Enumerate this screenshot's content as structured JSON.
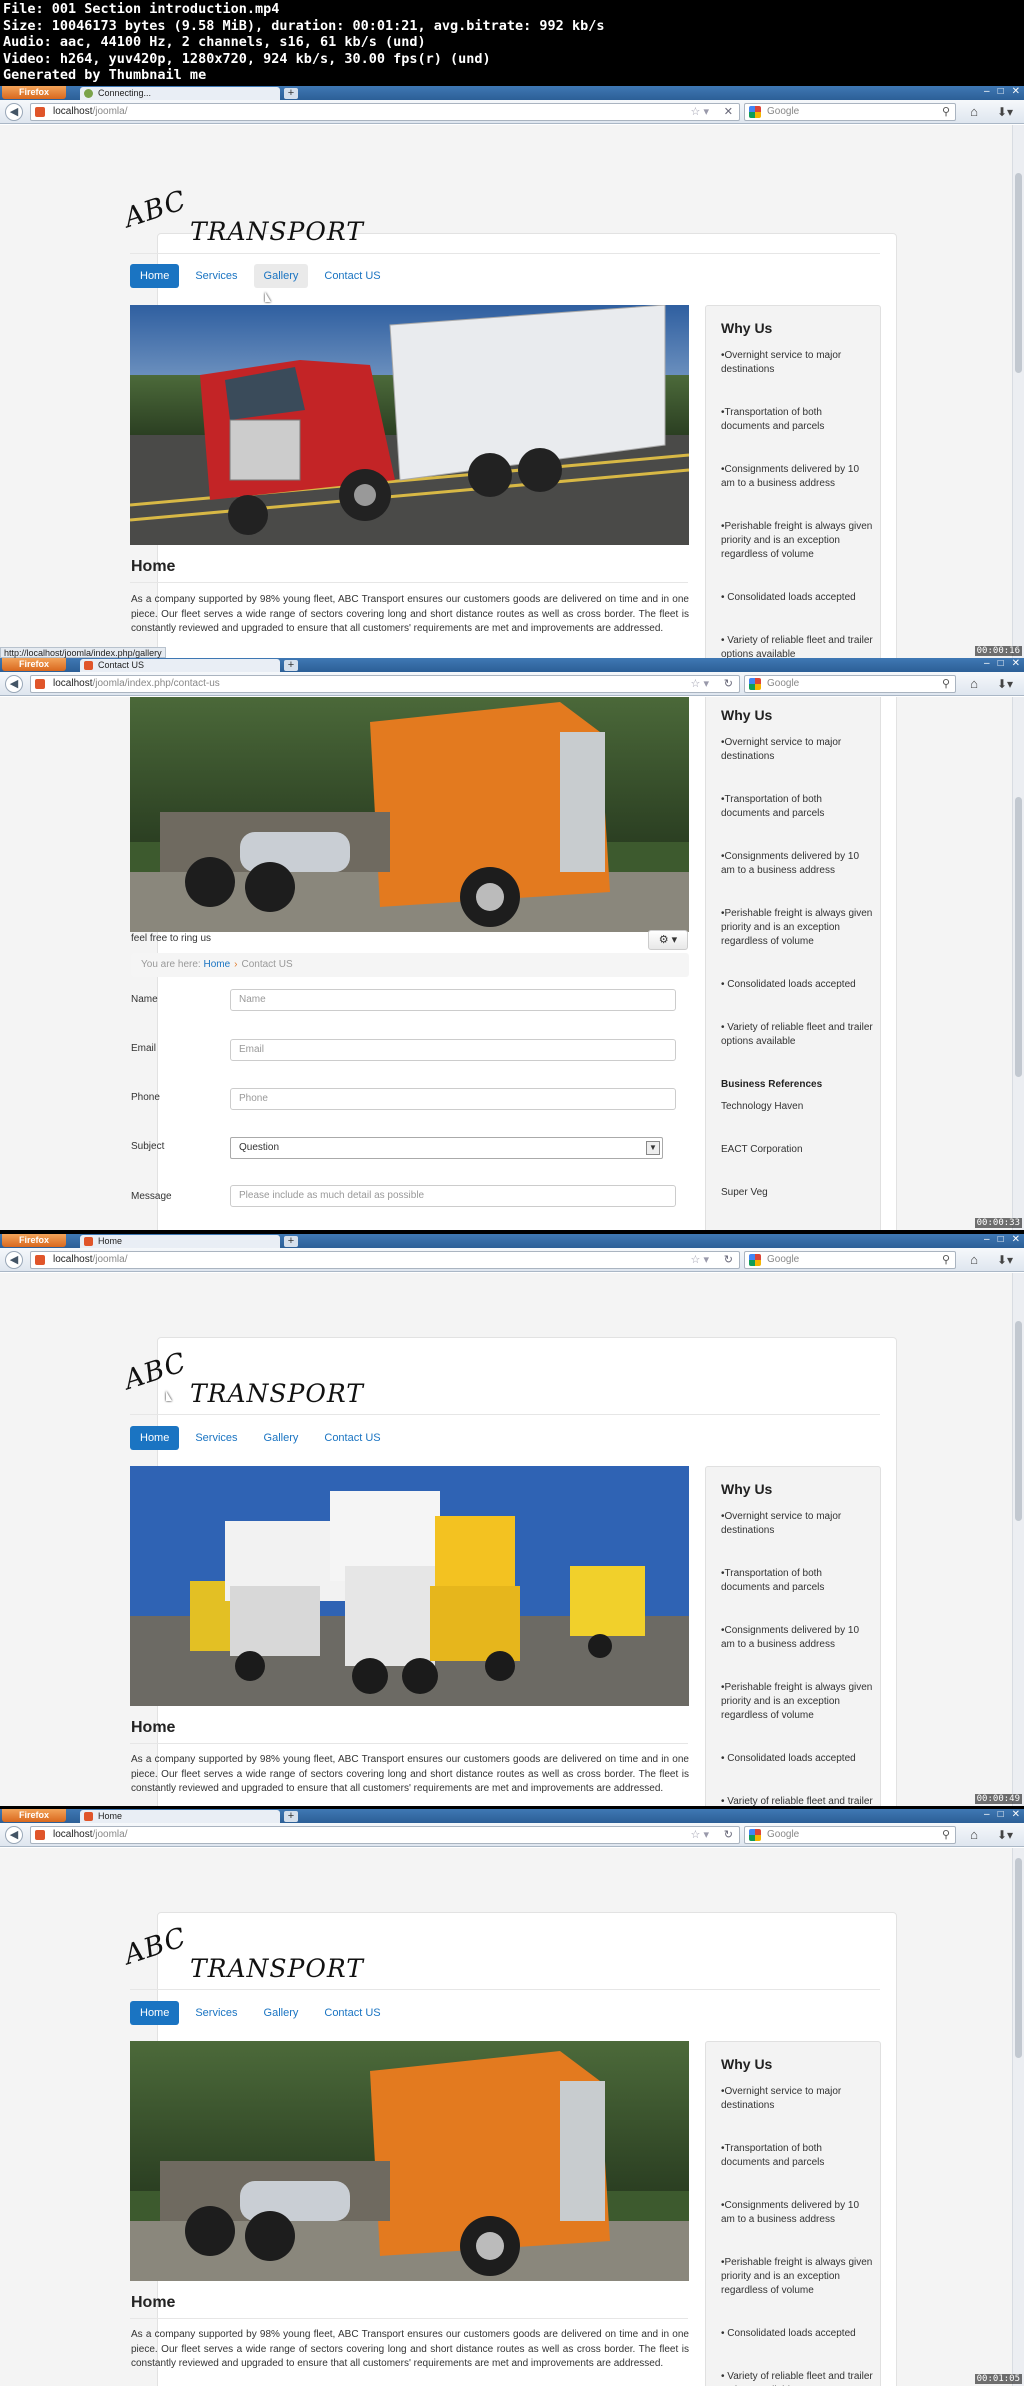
{
  "header": {
    "lines": [
      "File: 001 Section introduction.mp4",
      "Size: 10046173 bytes (9.58 MiB), duration: 00:01:21, avg.bitrate: 992 kb/s",
      "Audio: aac, 44100 Hz, 2 channels, s16, 61 kb/s (und)",
      "Video: h264, yuv420p, 1280x720, 924 kb/s, 30.00 fps(r) (und)",
      "Generated by Thumbnail me"
    ]
  },
  "browser": {
    "app_button": "Firefox",
    "search_placeholder": "Google",
    "new_tab": "+",
    "win_controls": [
      "–",
      "□",
      "✕"
    ]
  },
  "site": {
    "brand_abc": "ABC",
    "brand_transport": "TRANSPORT",
    "menu": [
      "Home",
      "Services",
      "Gallery",
      "Contact US"
    ],
    "home_heading": "Home",
    "home_text": "As a company supported by 98% young fleet, ABC Transport ensures our customers goods are delivered on time and in one piece. Our fleet serves a wide range of sectors covering long and short distance routes as well as cross border. The fleet is constantly reviewed and upgraded to ensure that all customers' requirements are met and improvements are addressed.",
    "why_title": "Why Us",
    "why_items": [
      "•Overnight service to major destinations",
      "•Transportation of both documents and parcels",
      "•Consignments delivered by 10 am to a business address",
      "•Perishable freight is always given priority and is an exception regardless of volume",
      "• Consolidated loads accepted",
      "• Variety of reliable fleet and trailer options available"
    ],
    "refs_title": "Business References",
    "refs": [
      "Technology Haven",
      "EACT Corporation",
      "Super Veg"
    ]
  },
  "frames": [
    {
      "tab_title": "Connecting...",
      "url_host": "localhost",
      "url_path": "/joomla/",
      "timestamp": "00:00:16",
      "status": "http://localhost/joomla/index.php/gallery"
    },
    {
      "tab_title": "Contact US",
      "url_host": "localhost",
      "url_path": "/joomla/index.php/contact-us",
      "timestamp": "00:00:33",
      "contact": {
        "intro": "feel free to ring us",
        "gear": "⚙ ▾",
        "crumb_label": "You are here:",
        "crumb_home": "Home",
        "crumb_current": "Contact US",
        "fields": [
          {
            "label": "Name",
            "placeholder": "Name"
          },
          {
            "label": "Email",
            "placeholder": "Email"
          },
          {
            "label": "Phone",
            "placeholder": "Phone"
          }
        ],
        "subject_label": "Subject",
        "subject_value": "Question",
        "message_label": "Message",
        "message_placeholder": "Please include as much detail as possible"
      }
    },
    {
      "tab_title": "Home",
      "url_host": "localhost",
      "url_path": "/joomla/",
      "timestamp": "00:00:49"
    },
    {
      "tab_title": "Home",
      "url_host": "localhost",
      "url_path": "/joomla/",
      "timestamp": "00:01:05"
    }
  ]
}
